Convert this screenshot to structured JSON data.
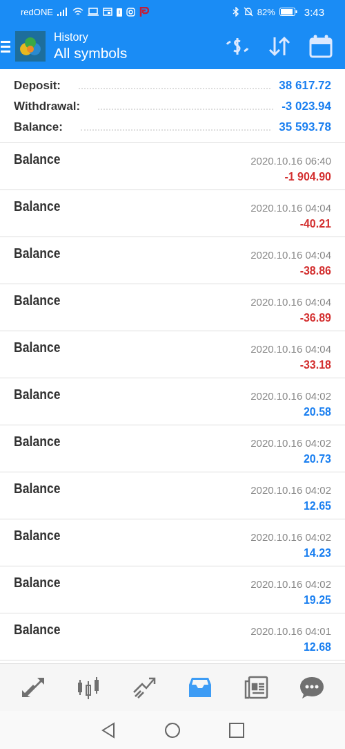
{
  "status_bar": {
    "carrier": "redONE",
    "battery": "82%",
    "time": "3:43"
  },
  "header": {
    "title": "History",
    "subtitle": "All symbols"
  },
  "summary": [
    {
      "label": "Deposit:",
      "value": "38 617.72"
    },
    {
      "label": "Withdrawal:",
      "value": "-3 023.94"
    },
    {
      "label": "Balance:",
      "value": "35 593.78"
    }
  ],
  "deals": [
    {
      "type": "Balance",
      "time": "2020.10.16 06:40",
      "amount": "-1 904.90",
      "color": "#d32f2f"
    },
    {
      "type": "Balance",
      "time": "2020.10.16 04:04",
      "amount": "-40.21",
      "color": "#d32f2f"
    },
    {
      "type": "Balance",
      "time": "2020.10.16 04:04",
      "amount": "-38.86",
      "color": "#d32f2f"
    },
    {
      "type": "Balance",
      "time": "2020.10.16 04:04",
      "amount": "-36.89",
      "color": "#d32f2f"
    },
    {
      "type": "Balance",
      "time": "2020.10.16 04:04",
      "amount": "-33.18",
      "color": "#d32f2f"
    },
    {
      "type": "Balance",
      "time": "2020.10.16 04:02",
      "amount": "20.58",
      "color": "#1a7ff0"
    },
    {
      "type": "Balance",
      "time": "2020.10.16 04:02",
      "amount": "20.73",
      "color": "#1a7ff0"
    },
    {
      "type": "Balance",
      "time": "2020.10.16 04:02",
      "amount": "12.65",
      "color": "#1a7ff0"
    },
    {
      "type": "Balance",
      "time": "2020.10.16 04:02",
      "amount": "14.23",
      "color": "#1a7ff0"
    },
    {
      "type": "Balance",
      "time": "2020.10.16 04:02",
      "amount": "19.25",
      "color": "#1a7ff0"
    },
    {
      "type": "Balance",
      "time": "2020.10.16 04:01",
      "amount": "12.68",
      "color": "#1a7ff0"
    }
  ],
  "bottom_nav": [
    {
      "kind": "quotes",
      "selected": false
    },
    {
      "kind": "chart",
      "selected": false
    },
    {
      "kind": "trade",
      "selected": false
    },
    {
      "kind": "history",
      "selected": true
    },
    {
      "kind": "news",
      "selected": false
    },
    {
      "kind": "chat",
      "selected": false
    }
  ]
}
